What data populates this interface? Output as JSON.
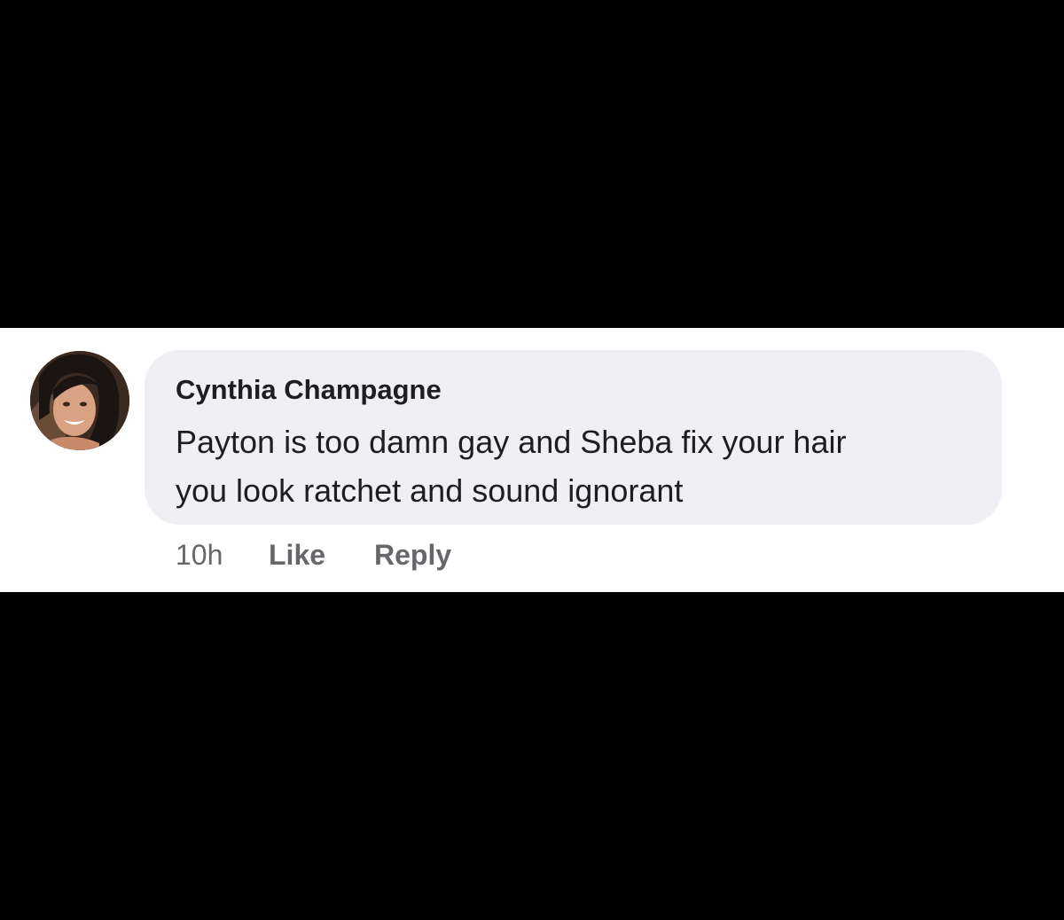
{
  "comment": {
    "author": "Cynthia Champagne",
    "text_lines": [
      "Payton is too damn gay and Sheba fix your hair",
      "you look ratchet and sound ignorant"
    ],
    "timestamp": "10h",
    "like_label": "Like",
    "reply_label": "Reply",
    "avatar_icon": "profile-photo"
  },
  "colors": {
    "background": "#000000",
    "strip": "#ffffff",
    "bubble": "#efeff4",
    "text": "#1c1e21",
    "meta": "#65676b"
  }
}
